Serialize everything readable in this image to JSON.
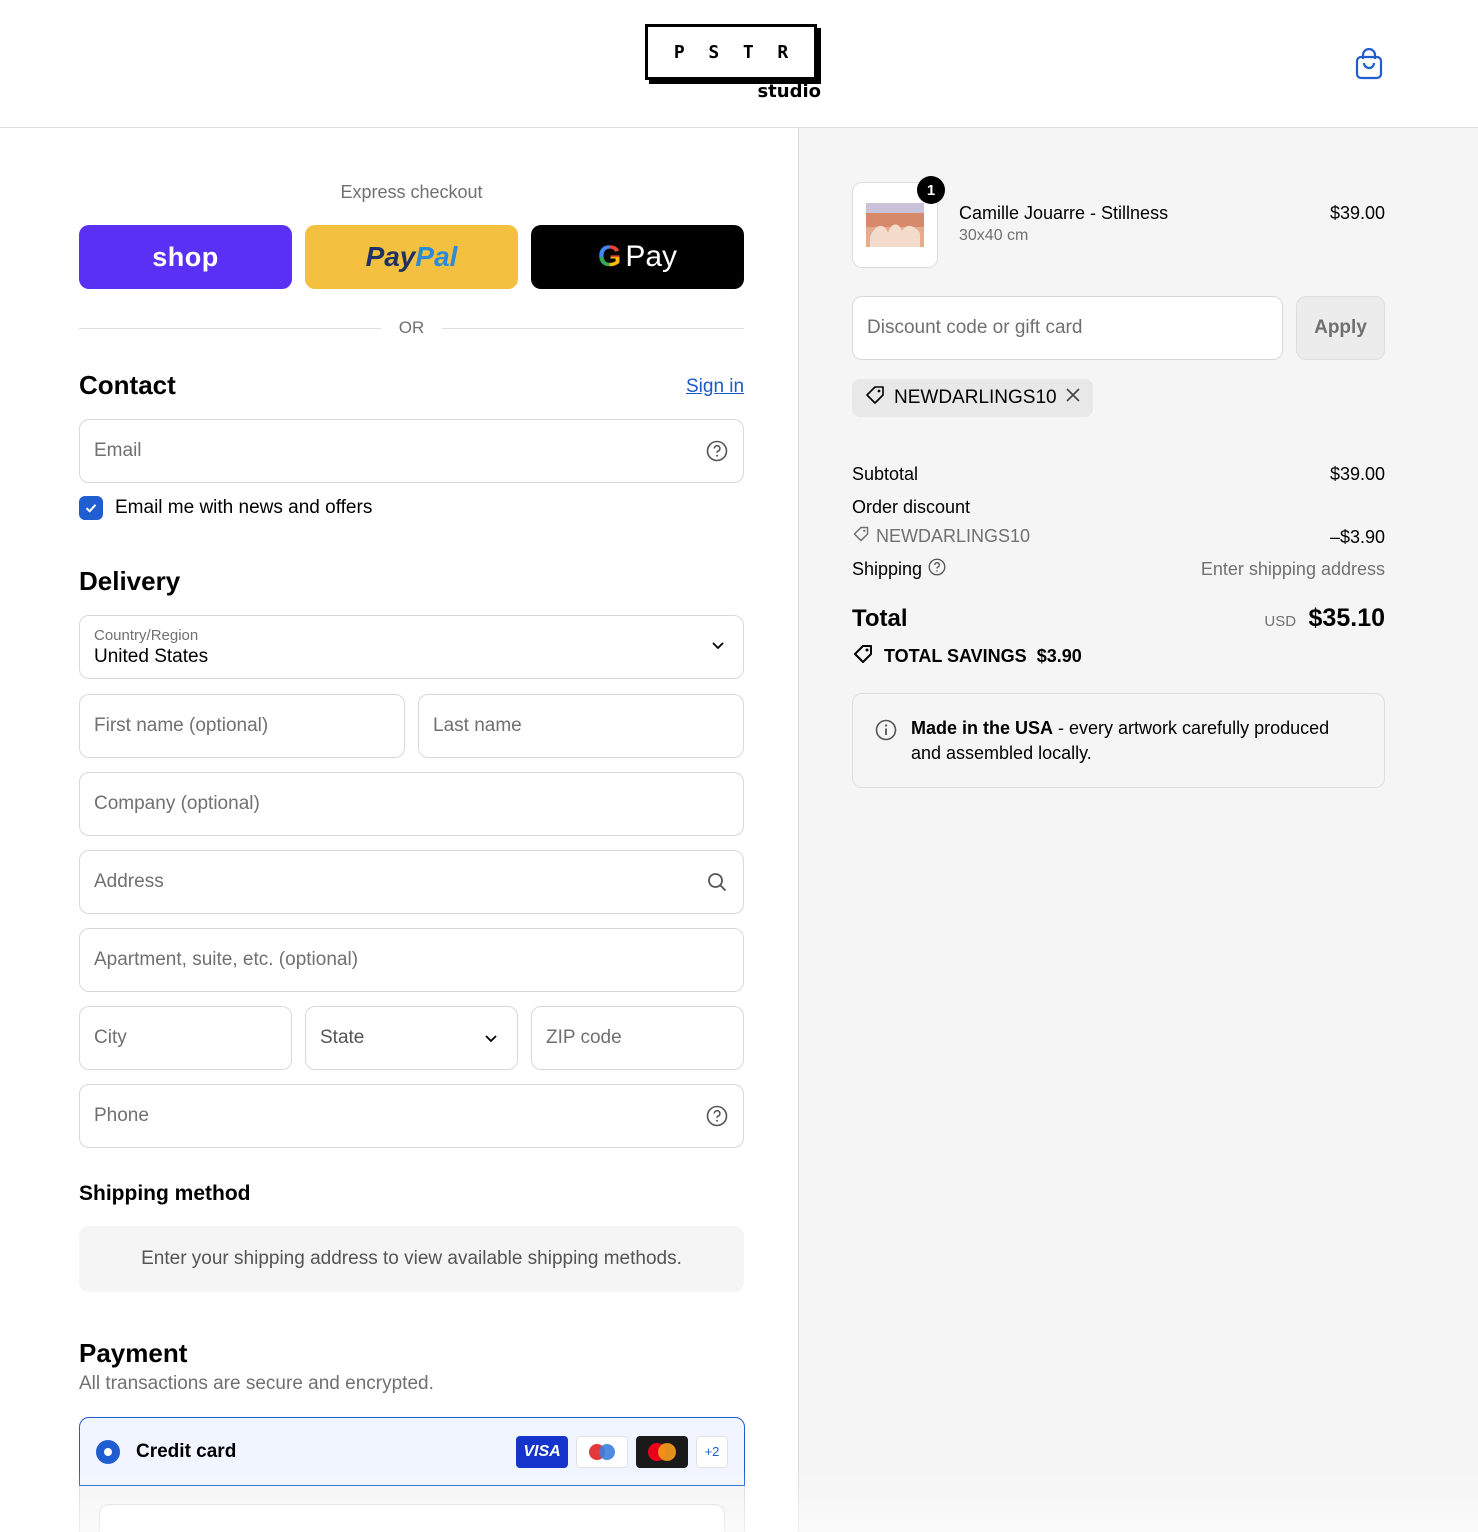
{
  "header": {
    "logo_letters": [
      "P",
      "S",
      "T",
      "R"
    ],
    "logo_sub": "studio",
    "cart_icon": "shopping-bag-icon"
  },
  "express": {
    "label": "Express checkout",
    "shop_label": "shop",
    "paypal_label_1": "Pay",
    "paypal_label_2": "Pal",
    "gpay_g": "G",
    "gpay_label": "Pay",
    "or_label": "OR"
  },
  "contact": {
    "title": "Contact",
    "sign_in": "Sign in",
    "email_placeholder": "Email",
    "newsletter_label": "Email me with news and offers",
    "newsletter_checked": true
  },
  "delivery": {
    "title": "Delivery",
    "country_label": "Country/Region",
    "country_value": "United States",
    "first_name_placeholder": "First name (optional)",
    "last_name_placeholder": "Last name",
    "company_placeholder": "Company (optional)",
    "address_placeholder": "Address",
    "apartment_placeholder": "Apartment, suite, etc. (optional)",
    "city_placeholder": "City",
    "state_placeholder": "State",
    "zip_placeholder": "ZIP code",
    "phone_placeholder": "Phone"
  },
  "shipping_method": {
    "title": "Shipping method",
    "notice": "Enter your shipping address to view available shipping methods."
  },
  "payment": {
    "title": "Payment",
    "subtitle": "All transactions are secure and encrypted.",
    "credit_card_label": "Credit card",
    "visa_label": "VISA",
    "more_cards": "+2"
  },
  "summary": {
    "product": {
      "quantity": "1",
      "name": "Camille Jouarre - Stillness",
      "variant": "30x40 cm",
      "price": "$39.00"
    },
    "discount_placeholder": "Discount code or gift card",
    "apply_label": "Apply",
    "applied_code": "NEWDARLINGS10",
    "subtotal_label": "Subtotal",
    "subtotal_value": "$39.00",
    "order_discount_label": "Order discount",
    "discount_code": "NEWDARLINGS10",
    "discount_value": "–$3.90",
    "shipping_label": "Shipping",
    "shipping_value": "Enter shipping address",
    "total_label": "Total",
    "currency": "USD",
    "total_value": "$35.10",
    "savings_label": "TOTAL SAVINGS",
    "savings_value": "$3.90",
    "info_bold": "Made in the USA",
    "info_text": " - every artwork carefully produced and assembled locally."
  },
  "colors": {
    "accent": "#1f5dd1",
    "shop_pay": "#5a31f4",
    "paypal": "#f3c03f",
    "gpay": "#000000",
    "panel_bg": "#f5f5f5"
  }
}
